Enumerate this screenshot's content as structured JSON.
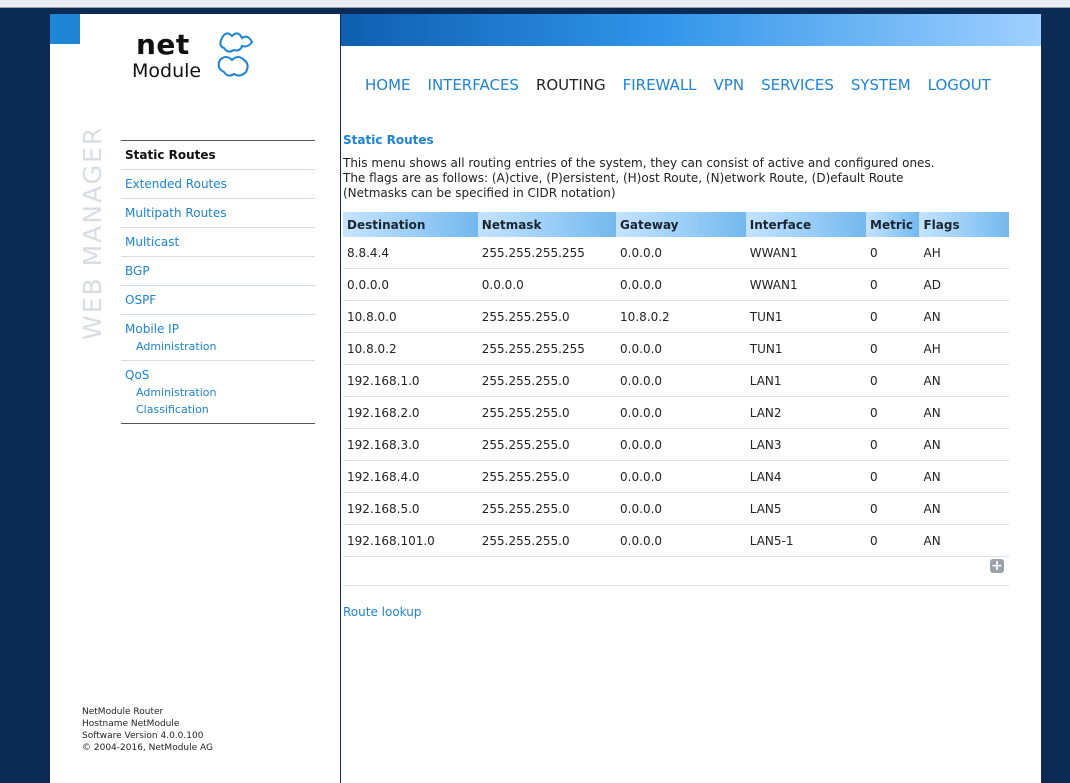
{
  "brand": {
    "logo_top": "net",
    "logo_bottom": "Module",
    "vertical_label": "WEB MANAGER",
    "accent_color": "#1d83d4"
  },
  "nav": {
    "items": [
      "HOME",
      "INTERFACES",
      "ROUTING",
      "FIREWALL",
      "VPN",
      "SERVICES",
      "SYSTEM",
      "LOGOUT"
    ],
    "active": "ROUTING"
  },
  "sidebar": {
    "items": [
      {
        "label": "Static Routes",
        "active": true,
        "subs": []
      },
      {
        "label": "Extended Routes",
        "subs": []
      },
      {
        "label": "Multipath Routes",
        "subs": []
      },
      {
        "label": "Multicast",
        "subs": []
      },
      {
        "label": "BGP",
        "subs": []
      },
      {
        "label": "OSPF",
        "subs": []
      },
      {
        "label": "Mobile IP",
        "subs": [
          "Administration"
        ]
      },
      {
        "label": "QoS",
        "subs": [
          "Administration",
          "Classification"
        ]
      }
    ]
  },
  "main": {
    "title": "Static Routes",
    "description": [
      "This menu shows all routing entries of the system, they can consist of active and configured ones.",
      "The flags are as follows: (A)ctive, (P)ersistent, (H)ost Route, (N)etwork Route, (D)efault Route",
      "(Netmasks can be specified in CIDR notation)"
    ],
    "table": {
      "columns": [
        "Destination",
        "Netmask",
        "Gateway",
        "Interface",
        "Metric",
        "Flags"
      ],
      "rows": [
        [
          "8.8.4.4",
          "255.255.255.255",
          "0.0.0.0",
          "WWAN1",
          "0",
          "AH"
        ],
        [
          "0.0.0.0",
          "0.0.0.0",
          "0.0.0.0",
          "WWAN1",
          "0",
          "AD"
        ],
        [
          "10.8.0.0",
          "255.255.255.0",
          "10.8.0.2",
          "TUN1",
          "0",
          "AN"
        ],
        [
          "10.8.0.2",
          "255.255.255.255",
          "0.0.0.0",
          "TUN1",
          "0",
          "AH"
        ],
        [
          "192.168.1.0",
          "255.255.255.0",
          "0.0.0.0",
          "LAN1",
          "0",
          "AN"
        ],
        [
          "192.168.2.0",
          "255.255.255.0",
          "0.0.0.0",
          "LAN2",
          "0",
          "AN"
        ],
        [
          "192.168.3.0",
          "255.255.255.0",
          "0.0.0.0",
          "LAN3",
          "0",
          "AN"
        ],
        [
          "192.168.4.0",
          "255.255.255.0",
          "0.0.0.0",
          "LAN4",
          "0",
          "AN"
        ],
        [
          "192.168.5.0",
          "255.255.255.0",
          "0.0.0.0",
          "LAN5",
          "0",
          "AN"
        ],
        [
          "192.168.101.0",
          "255.255.255.0",
          "0.0.0.0",
          "LAN5-1",
          "0",
          "AN"
        ]
      ]
    },
    "add_icon": "plus-icon",
    "route_lookup": "Route lookup"
  },
  "footer": {
    "lines": [
      "NetModule Router",
      "Hostname NetModule",
      "Software Version 4.0.0.100",
      "© 2004-2016, NetModule AG"
    ]
  }
}
